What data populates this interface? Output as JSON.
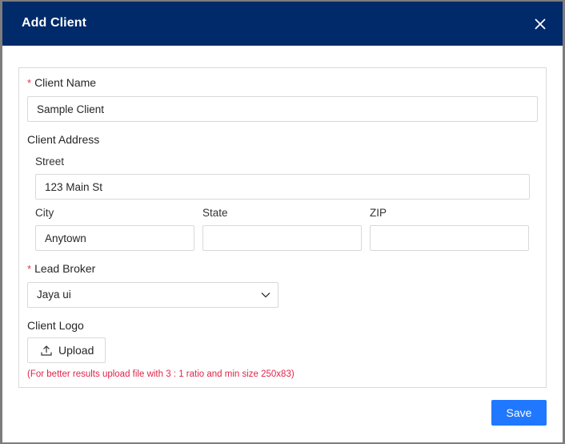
{
  "modal": {
    "title": "Add Client",
    "close_icon": "close-icon"
  },
  "form": {
    "client_name": {
      "label": "Client Name",
      "required_mark": "*",
      "value": "Sample Client"
    },
    "client_address": {
      "label": "Client Address",
      "street": {
        "label": "Street",
        "value": "123 Main St"
      },
      "city": {
        "label": "City",
        "value": "Anytown"
      },
      "state": {
        "label": "State",
        "value": ""
      },
      "zip": {
        "label": "ZIP",
        "value": ""
      }
    },
    "lead_broker": {
      "label": "Lead Broker",
      "required_mark": "*",
      "selected": "Jaya ui",
      "arrow_icon": "chevron-down-icon"
    },
    "client_logo": {
      "label": "Client Logo",
      "upload_label": "Upload",
      "upload_icon": "upload-icon",
      "hint": "(For better results upload file with 3 : 1 ratio and min size 250x83)"
    }
  },
  "footer": {
    "save_label": "Save"
  },
  "colors": {
    "header_bg": "#002a6a",
    "primary": "#1f78ff",
    "required": "#e6334d",
    "hint": "#e0244b"
  }
}
